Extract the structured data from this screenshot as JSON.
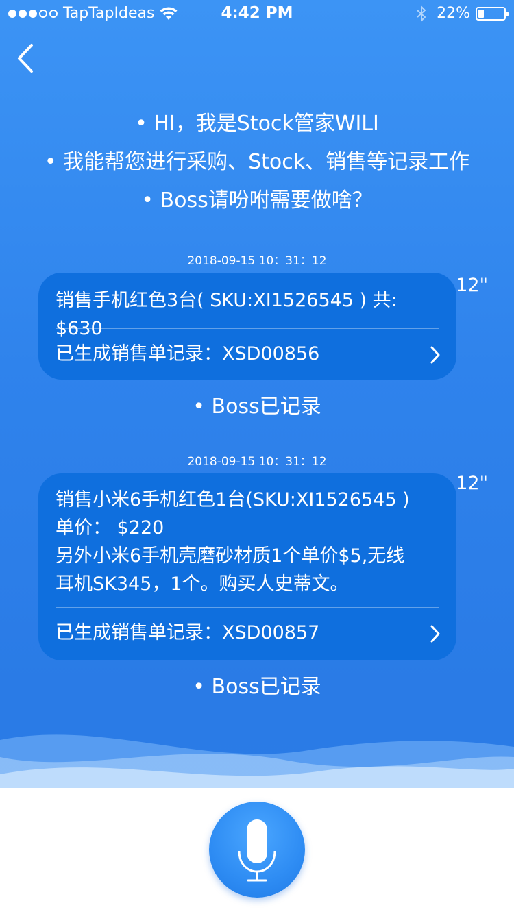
{
  "status_bar": {
    "carrier": "TapTapIdeas",
    "time": "4:42 PM",
    "battery": "22%",
    "battery_level": 0.22
  },
  "intro_lines": [
    "• HI，我是Stock管家WILI",
    "• 我能帮您进行采购、Stock、销售等记录工作",
    "• Boss请吩咐需要做啥？"
  ],
  "messages": [
    {
      "timestamp": "2018-09-15 10：31：12",
      "lines": [
        "销售手机红色3台( SKU:XI1526545 ) 共: $630"
      ],
      "record": "已生成销售单记录：XSD00856",
      "duration": "12\"",
      "confirm": "• Boss已记录"
    },
    {
      "timestamp": "2018-09-15 10：31：12",
      "lines": [
        "销售小米6手机红色1台(SKU:XI1526545 )",
        "单价：  $220",
        "另外小米6手机壳磨砂材质1个单价$5,无线",
        "耳机SK345，1个。购买人史蒂文。"
      ],
      "record": "已生成销售单记录：XSD00857",
      "duration": "12\"",
      "confirm": "• Boss已记录"
    }
  ],
  "icons": {
    "back": "chevron-left-icon",
    "record_arrow": "chevron-right-icon",
    "mic": "microphone-icon"
  },
  "colors": {
    "background": "#2f83ec",
    "bubble": "#0f6fde",
    "text": "#ffffff"
  }
}
